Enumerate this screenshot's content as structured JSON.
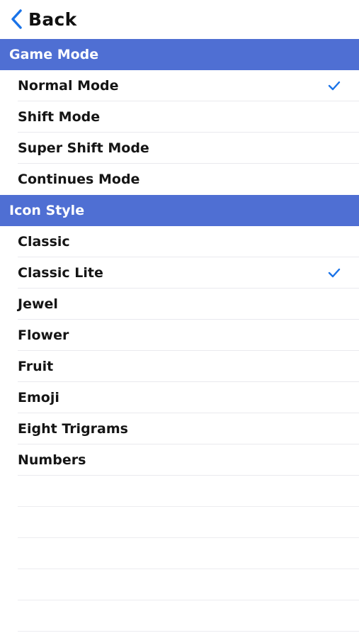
{
  "nav": {
    "back_label": "Back",
    "back_icon": "chevron-left-icon"
  },
  "colors": {
    "accent": "#1a73e8",
    "section_header_bg": "#4f6fd3",
    "section_header_text": "#ffffff"
  },
  "sections": [
    {
      "title": "Game Mode",
      "items": [
        {
          "label": "Normal Mode",
          "selected": true
        },
        {
          "label": "Shift Mode",
          "selected": false
        },
        {
          "label": "Super Shift Mode",
          "selected": false
        },
        {
          "label": "Continues Mode",
          "selected": false
        }
      ]
    },
    {
      "title": "Icon Style",
      "items": [
        {
          "label": "Classic",
          "selected": false
        },
        {
          "label": "Classic Lite",
          "selected": true
        },
        {
          "label": "Jewel",
          "selected": false
        },
        {
          "label": "Flower",
          "selected": false
        },
        {
          "label": "Fruit",
          "selected": false
        },
        {
          "label": "Emoji",
          "selected": false
        },
        {
          "label": "Eight Trigrams",
          "selected": false
        },
        {
          "label": "Numbers",
          "selected": false
        }
      ]
    }
  ]
}
